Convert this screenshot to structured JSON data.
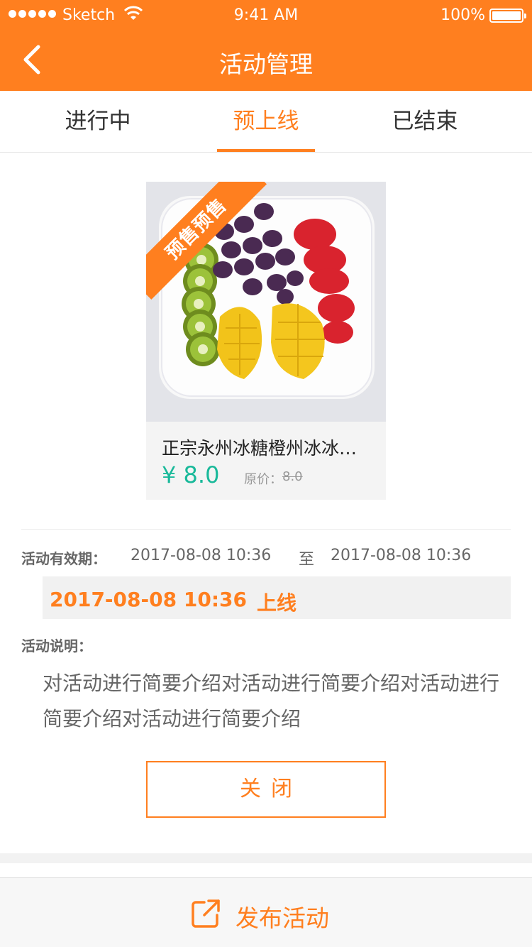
{
  "status_bar": {
    "carrier": "Sketch",
    "time": "9:41 AM",
    "battery": "100%"
  },
  "nav": {
    "title": "活动管理",
    "back_icon": "chevron-left-icon"
  },
  "tabs": [
    {
      "label": "进行中",
      "active": false
    },
    {
      "label": "预上线",
      "active": true
    },
    {
      "label": "已结束",
      "active": false
    }
  ],
  "product": {
    "ribbon": "预售预售",
    "name": "正宗永州冰糖橙州冰冰…",
    "price": "¥ 8.0",
    "original_label": "原价：",
    "original_price": "8.0",
    "image": "fruit-plate-image"
  },
  "activity": {
    "period_label": "活动有效期：",
    "period_start": "2017-08-08  10:36",
    "period_to": "至",
    "period_end": "2017-08-08  10:36",
    "online_time": "2017-08-08  10:36",
    "online_status": "上线",
    "desc_label": "活动说明：",
    "desc_text": "对活动进行简要介绍对活动进行简要介绍对活动进行简要介绍对活动进行简要介绍"
  },
  "actions": {
    "close_label": "关闭",
    "publish_label": "发布活动",
    "publish_icon": "share-external-icon"
  },
  "colors": {
    "accent": "#ff7f1f",
    "price": "#19b99a"
  }
}
